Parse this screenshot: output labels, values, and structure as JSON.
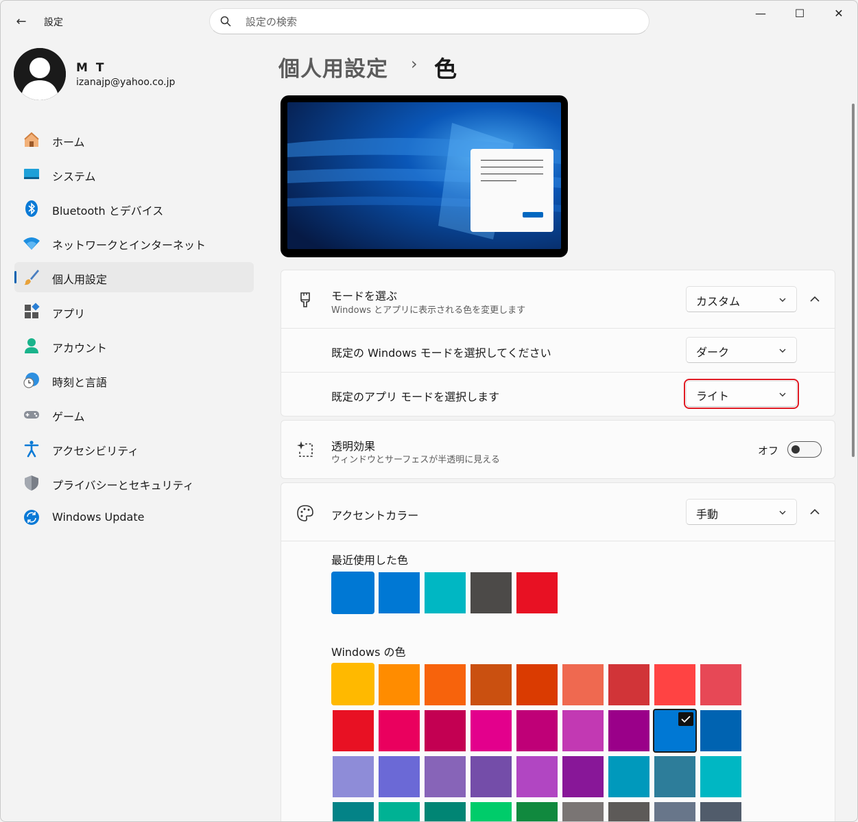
{
  "window": {
    "title": "設定",
    "back_icon": "back-arrow-icon",
    "controls": {
      "minimize": "—",
      "maximize": "☐",
      "close": "✕"
    }
  },
  "search": {
    "placeholder": "設定の検索",
    "value": ""
  },
  "user": {
    "name": "M T",
    "email": "izanajp@yahoo.co.jp"
  },
  "sidebar": {
    "items": [
      {
        "label": "ホーム",
        "icon": "home-icon"
      },
      {
        "label": "システム",
        "icon": "system-icon"
      },
      {
        "label": "Bluetooth とデバイス",
        "icon": "bluetooth-icon"
      },
      {
        "label": "ネットワークとインターネット",
        "icon": "wifi-icon"
      },
      {
        "label": "個人用設定",
        "icon": "brush-icon",
        "selected": true
      },
      {
        "label": "アプリ",
        "icon": "apps-icon"
      },
      {
        "label": "アカウント",
        "icon": "account-icon"
      },
      {
        "label": "時刻と言語",
        "icon": "time-language-icon"
      },
      {
        "label": "ゲーム",
        "icon": "gamepad-icon"
      },
      {
        "label": "アクセシビリティ",
        "icon": "accessibility-icon"
      },
      {
        "label": "プライバシーとセキュリティ",
        "icon": "shield-icon"
      },
      {
        "label": "Windows Update",
        "icon": "windows-update-icon"
      }
    ]
  },
  "breadcrumb": {
    "parent": "個人用設定",
    "separator": "›",
    "current": "色"
  },
  "mode": {
    "title": "モードを選ぶ",
    "subtitle": "Windows とアプリに表示される色を変更します",
    "value": "カスタム",
    "windows_mode_label": "既定の Windows モードを選択してください",
    "windows_mode_value": "ダーク",
    "app_mode_label": "既定のアプリ モードを選択します",
    "app_mode_value": "ライト"
  },
  "transparency": {
    "title": "透明効果",
    "subtitle": "ウィンドウとサーフェスが半透明に見える",
    "state_label": "オフ",
    "enabled": false
  },
  "accent": {
    "title": "アクセントカラー",
    "value": "手動",
    "recent_label": "最近使用した色",
    "recent_colors": [
      "#0078d4",
      "#0078d4",
      "#00b7c3",
      "#4c4a48",
      "#e81123"
    ],
    "windows_label": "Windows の色",
    "windows_colors": [
      [
        "#ffb900",
        "#ff8c00",
        "#f7630c",
        "#ca5010",
        "#da3b01",
        "#ef6950",
        "#d13438",
        "#ff4343",
        "#e74856"
      ],
      [
        "#e81123",
        "#ea005e",
        "#c30052",
        "#e3008c",
        "#bf0077",
        "#c239b3",
        "#9a0089",
        "#0078d4",
        "#0063b1"
      ],
      [
        "#8e8cd8",
        "#6b69d6",
        "#8764b8",
        "#744da9",
        "#b146c2",
        "#881798",
        "#0099bc",
        "#2d7d9a",
        "#00b7c3"
      ],
      [
        "#038387",
        "#00b294",
        "#018574",
        "#00cc6a",
        "#10893e",
        "#7a7574",
        "#5d5a58",
        "#68768a",
        "#515c6b"
      ]
    ],
    "selected_index": [
      1,
      7
    ]
  }
}
